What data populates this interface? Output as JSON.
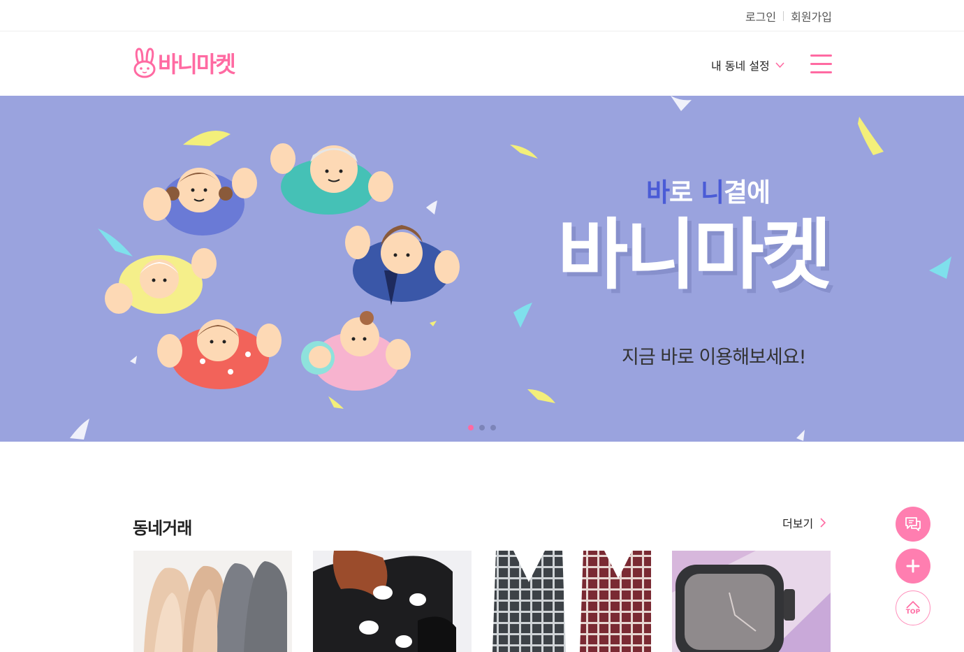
{
  "topbar": {
    "login": "로그인",
    "signup": "회원가입"
  },
  "header": {
    "logo": "바니마켓",
    "neighborhood": "내 동네 설정"
  },
  "hero": {
    "subtitle_part1": "바",
    "subtitle_part2": "로 ",
    "subtitle_part3": "니",
    "subtitle_part4": "곁에",
    "title": "바니마켓",
    "tagline": "지금 바로 이용해보세요!",
    "slide_count": 3,
    "active_slide": 1
  },
  "section": {
    "title": "동네거래",
    "more": "더보기"
  },
  "fabs": {
    "top_label": "TOP"
  },
  "colors": {
    "brand": "#ff6aa2",
    "hero_bg": "#9aa3de",
    "accent_blue": "#4a5bd6"
  },
  "icons": [
    "bunny-logo-icon",
    "chevron-down-icon",
    "menu-icon",
    "chevron-right-icon",
    "chat-icon",
    "plus-icon",
    "chevron-up-icon"
  ]
}
